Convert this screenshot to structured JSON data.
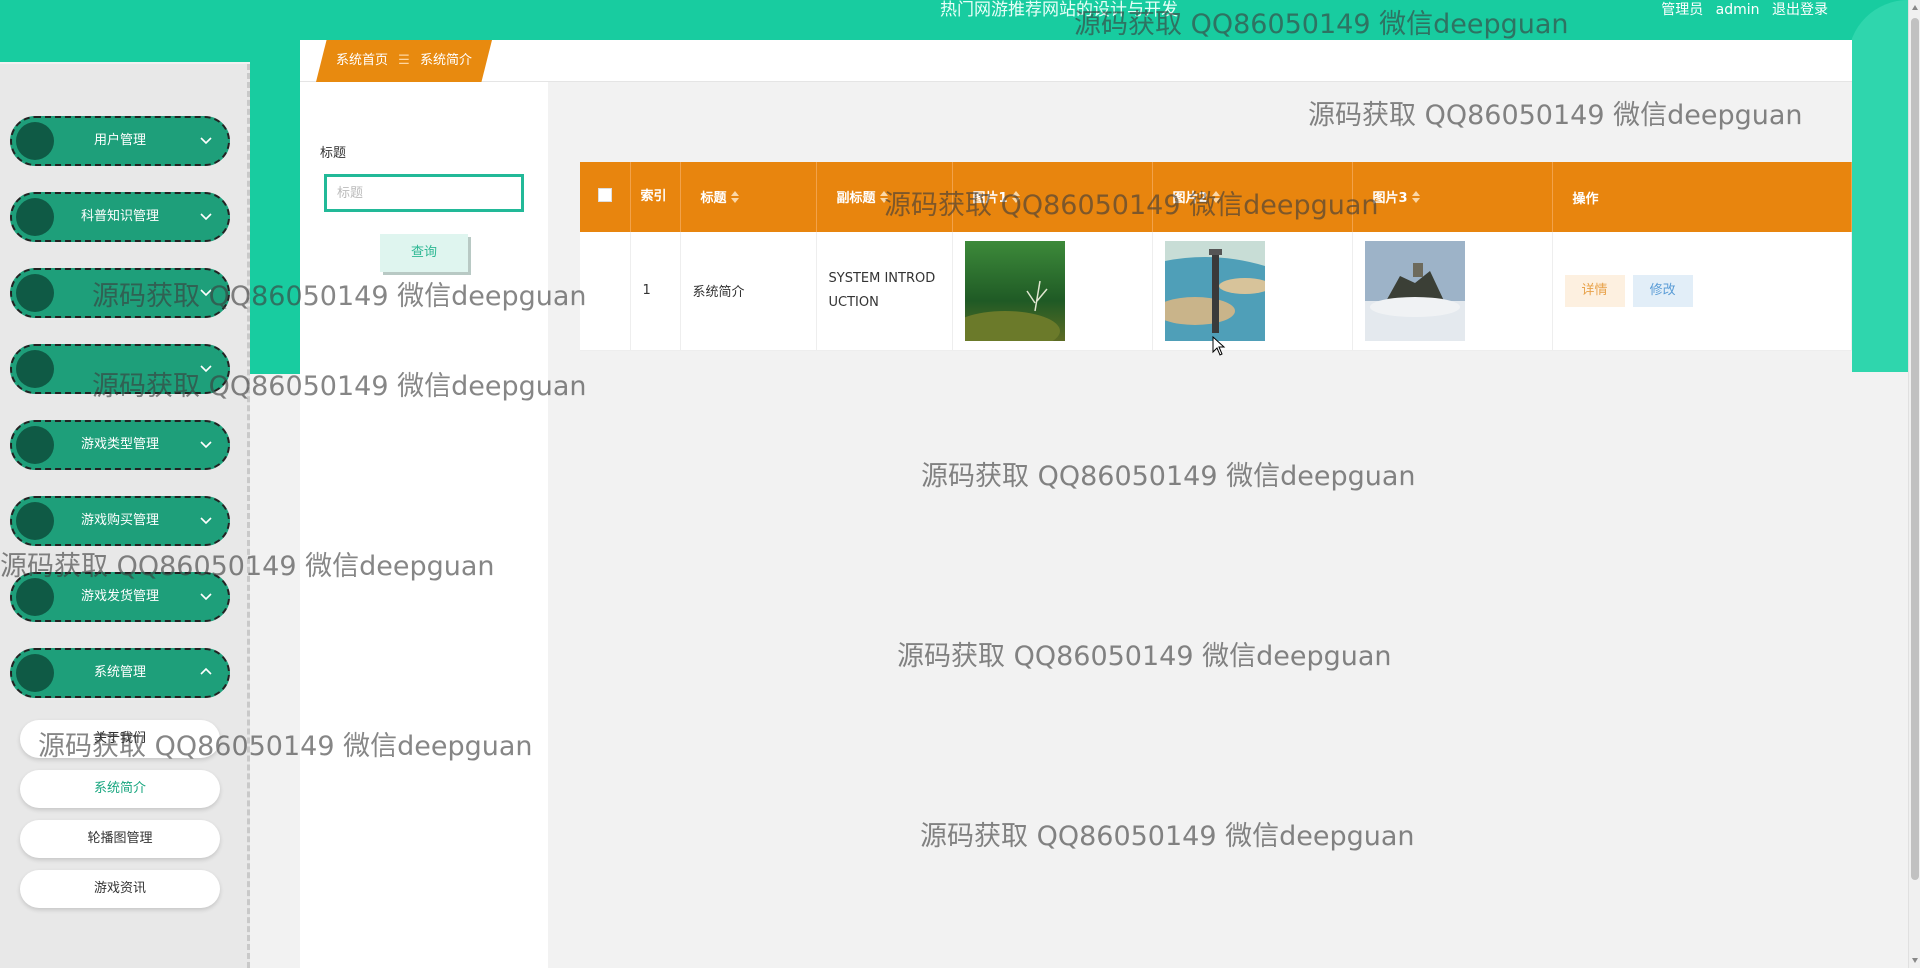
{
  "header": {
    "title": "热门网游推荐网站的设计与开发",
    "user_role": "管理员",
    "username": "admin",
    "logout": "退出登录"
  },
  "sidebar": {
    "items": [
      {
        "label": "用户管理",
        "icon": "chevron-down-icon"
      },
      {
        "label": "科普知识管理",
        "icon": "chevron-down-icon"
      },
      {
        "label": "游戏类型管理",
        "icon": "chevron-down-icon"
      },
      {
        "label": "游戏购买管理",
        "icon": "chevron-down-icon"
      },
      {
        "label": "游戏发货管理",
        "icon": "chevron-down-icon"
      },
      {
        "label": "系统管理",
        "icon": "chevron-up-icon"
      }
    ],
    "sub_items": [
      "关于我们",
      "系统简介",
      "轮播图管理",
      "游戏资讯"
    ],
    "active_sub": "系统简介"
  },
  "breadcrumb": {
    "home": "系统首页",
    "separator": "☰",
    "current": "系统简介"
  },
  "search": {
    "label": "标题",
    "placeholder": "标题",
    "value": "",
    "button": "查询"
  },
  "table": {
    "headers": [
      "索引",
      "标题",
      "副标题",
      "图片1",
      "图片2",
      "图片3",
      "操作"
    ],
    "rows": [
      {
        "index": "1",
        "title": "系统简介",
        "subtitle": "SYSTEM INTRODUCTION",
        "detail": "详情",
        "edit": "修改"
      }
    ]
  },
  "watermark": "源码获取 QQ86050149 微信deepguan",
  "colors": {
    "topbar": "#18cca0",
    "menu": "#1e9f7a",
    "table_header": "#e8850e",
    "accent": "#22b998"
  }
}
